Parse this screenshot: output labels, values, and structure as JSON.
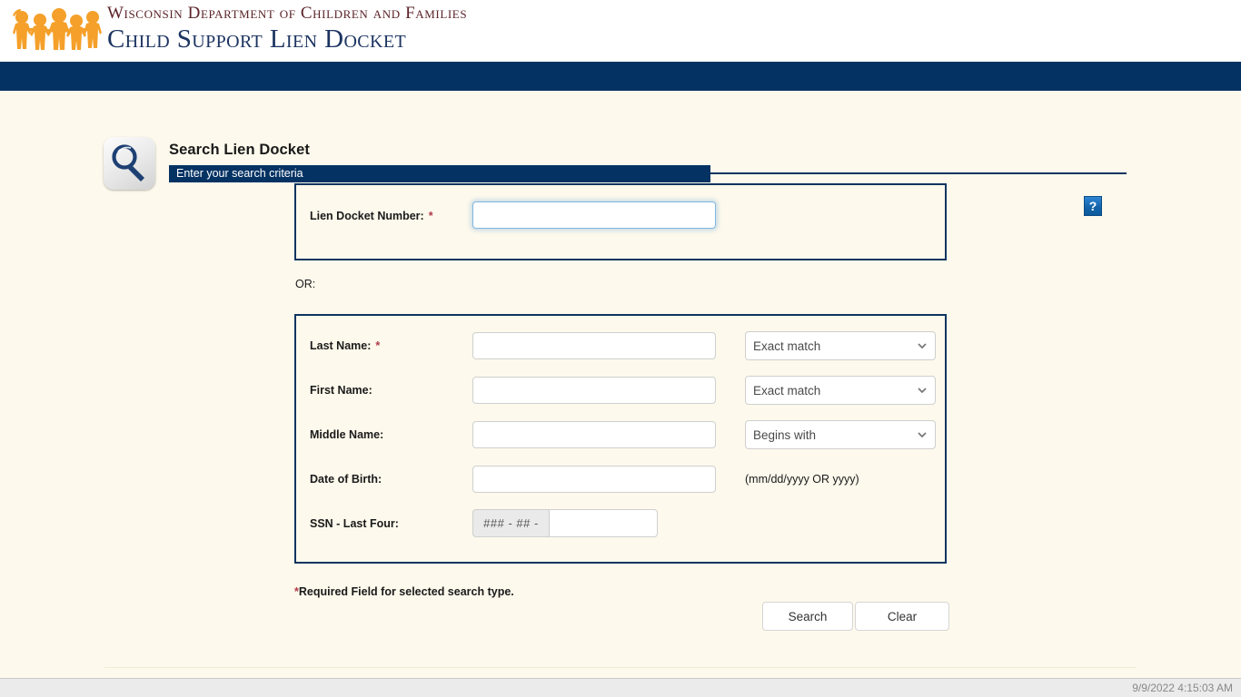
{
  "masthead": {
    "agency_name": "Wisconsin Department of Children and Families",
    "application_name": "Child Support Lien Docket",
    "logo_icon": "children-holding-hands-logo",
    "logo_color": "#F5A02A",
    "agency_name_color": "#5B2328",
    "application_name_color": "#1C3461",
    "navbar_color": "#043263"
  },
  "page": {
    "title": "Search Lien Docket",
    "subtitle": "Enter your search criteria",
    "search_icon": "magnifier-icon",
    "help_icon_label": "?",
    "accent_color": "#043263",
    "background_color": "#FDF9EC"
  },
  "docket_panel": {
    "label": "Lien Docket Number:",
    "required_marker": "*",
    "value": "",
    "placeholder": ""
  },
  "or_label": "OR:",
  "person_panel": {
    "rows": [
      {
        "label": "Last Name:",
        "required_marker": "*",
        "value": "",
        "match_option": "Exact match"
      },
      {
        "label": "First Name:",
        "required_marker": "",
        "value": "",
        "match_option": "Exact match"
      },
      {
        "label": "Middle Name:",
        "required_marker": "",
        "value": "",
        "match_option": "Begins with"
      }
    ],
    "match_options": [
      "Exact match",
      "Begins with"
    ],
    "date_of_birth": {
      "label": "Date of Birth:",
      "value": "",
      "hint": "(mm/dd/yyyy OR yyyy)"
    },
    "ssn": {
      "label": "SSN - Last Four:",
      "prefix": "### - ## -",
      "value": ""
    }
  },
  "footnote": {
    "star": "*",
    "text": "Required Field for selected search type."
  },
  "actions": {
    "search_label": "Search",
    "clear_label": "Clear"
  },
  "footer": {
    "timestamp": "9/9/2022 4:15:03 AM"
  }
}
